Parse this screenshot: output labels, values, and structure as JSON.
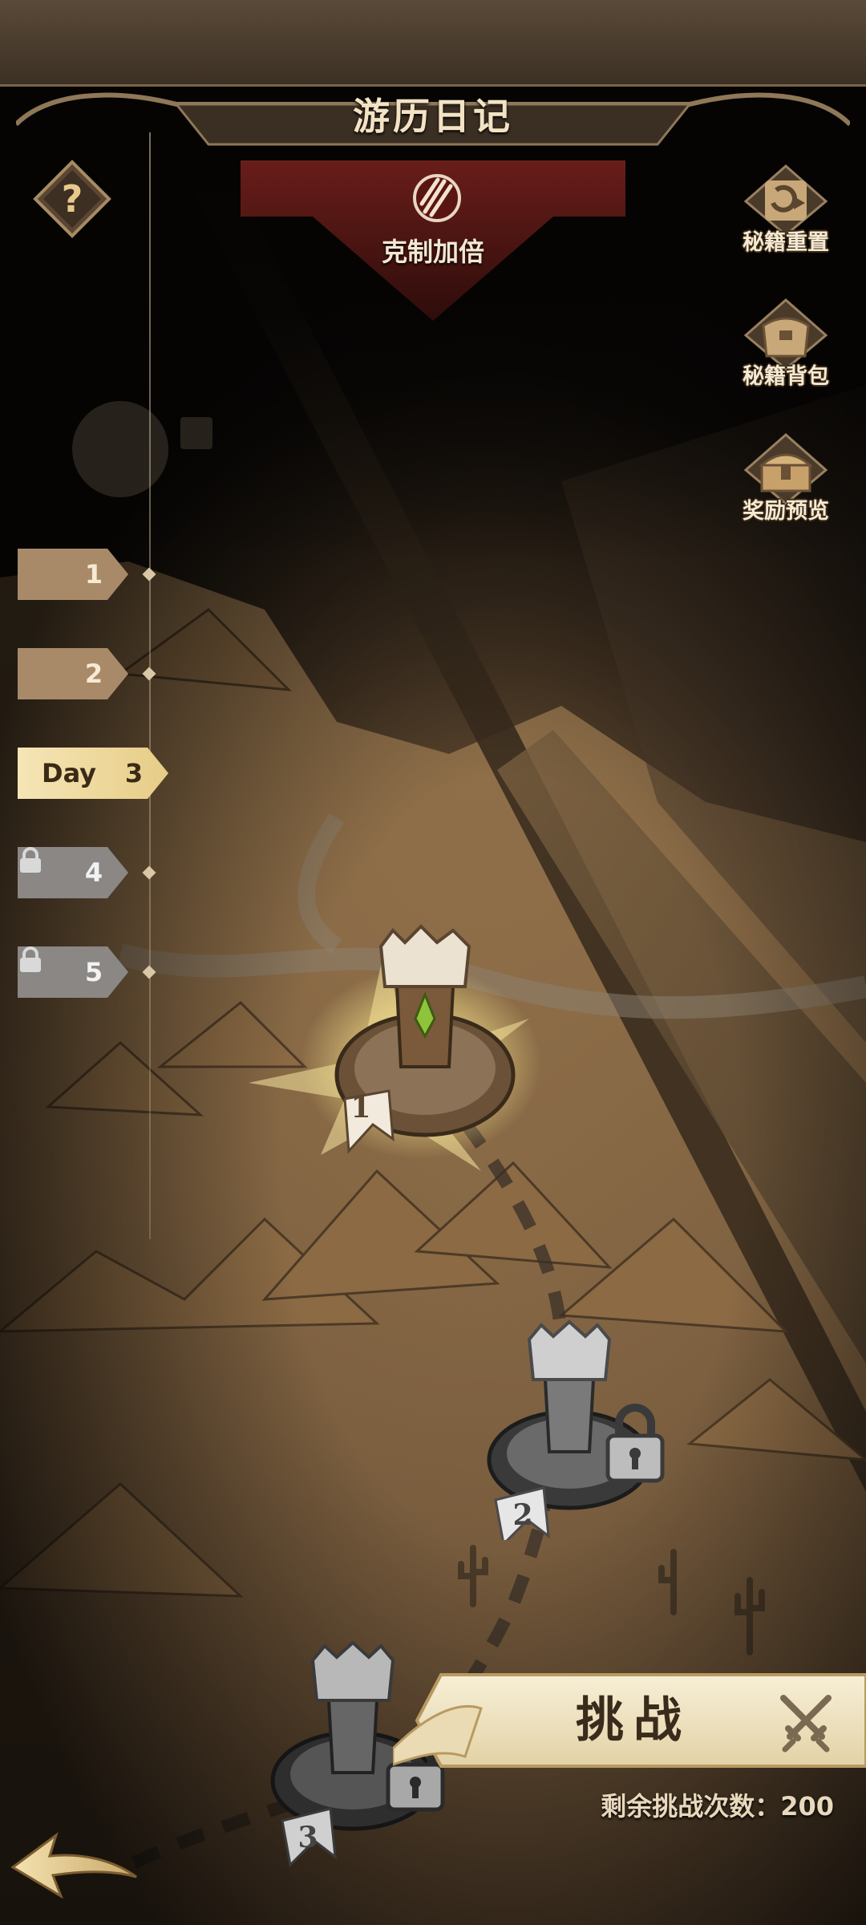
{
  "header": {
    "title": "游历日记"
  },
  "buff": {
    "label": "克制加倍",
    "icon": "claw-slash-icon"
  },
  "side_buttons": [
    {
      "label": "秘籍重置",
      "icon": "scroll-reset-icon"
    },
    {
      "label": "秘籍背包",
      "icon": "bag-icon"
    },
    {
      "label": "奖励预览",
      "icon": "treasure-chest-icon"
    }
  ],
  "days": [
    {
      "number": "1",
      "state": "unlocked"
    },
    {
      "number": "2",
      "state": "unlocked"
    },
    {
      "word": "Day",
      "number": "3",
      "state": "active"
    },
    {
      "number": "4",
      "state": "locked"
    },
    {
      "number": "5",
      "state": "locked"
    }
  ],
  "stages": [
    {
      "number": "1",
      "state": "active"
    },
    {
      "number": "2",
      "state": "locked"
    },
    {
      "number": "3",
      "state": "locked"
    }
  ],
  "challenge": {
    "label": "挑战",
    "remaining_label": "剩余挑战次数：",
    "remaining_count": "200"
  },
  "colors": {
    "accent_gold": "#f3e2ae",
    "banner_red": "#7a1f1c",
    "parchment": "#c9a877"
  }
}
